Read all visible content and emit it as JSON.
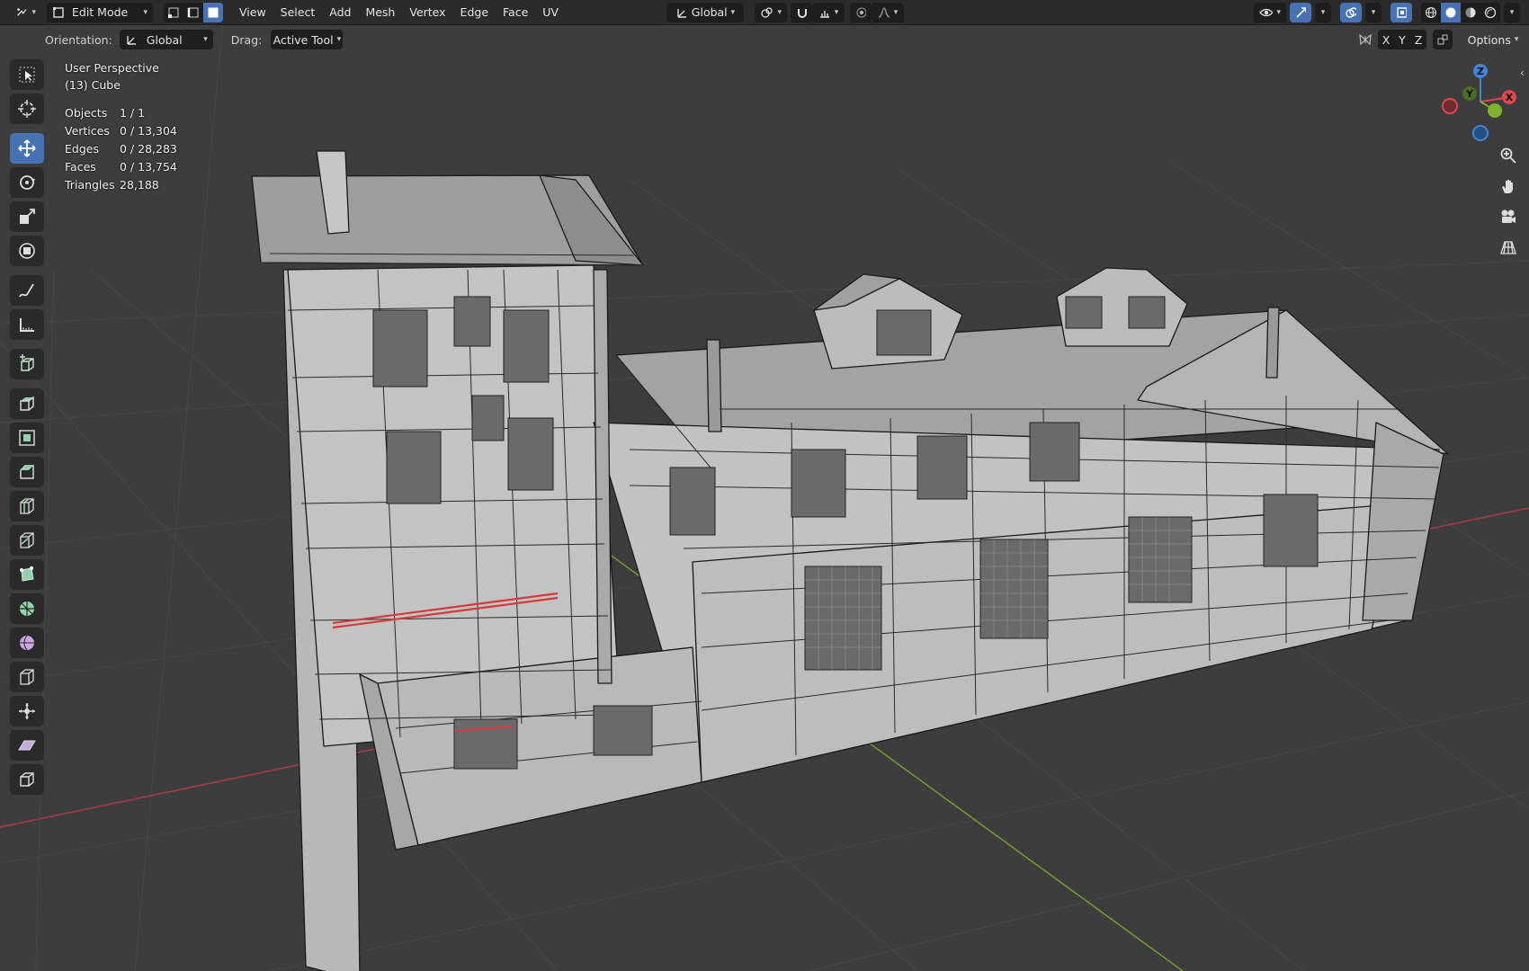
{
  "header": {
    "mode_label": "Edit Mode",
    "menus": [
      "View",
      "Select",
      "Add",
      "Mesh",
      "Vertex",
      "Edge",
      "Face",
      "UV"
    ],
    "transform_orientation": "Global"
  },
  "tool_settings": {
    "orientation_label": "Orientation:",
    "orientation_value": "Global",
    "drag_label": "Drag:",
    "drag_value": "Active Tool",
    "axis_x": "X",
    "axis_y": "Y",
    "axis_z": "Z",
    "options_label": "Options"
  },
  "overlay": {
    "view_name": "User Perspective",
    "object_name": "(13) Cube",
    "stats": [
      {
        "label": "Objects",
        "value": "1 / 1"
      },
      {
        "label": "Vertices",
        "value": "0 / 13,304"
      },
      {
        "label": "Edges",
        "value": "0 / 28,283"
      },
      {
        "label": "Faces",
        "value": "0 / 13,754"
      },
      {
        "label": "Triangles",
        "value": "28,188"
      }
    ]
  },
  "gizmo": {
    "x": "X",
    "y": "Y",
    "z": "Z"
  },
  "colors": {
    "accent": "#4772b3",
    "axis_x": "#e0474d",
    "axis_y": "#7fb32e",
    "axis_z": "#3f85db",
    "background": "#3d3d3d"
  },
  "toolbar_icons": [
    "select-box-icon",
    "cursor-icon",
    "move-icon",
    "rotate-icon",
    "scale-icon",
    "transform-icon",
    "annotate-icon",
    "measure-icon",
    "add-cube-icon",
    "extrude-region-icon",
    "inset-faces-icon",
    "bevel-icon",
    "loop-cut-icon",
    "knife-icon",
    "poly-build-icon",
    "spin-icon",
    "smooth-icon",
    "edge-slide-icon",
    "shrink-fatten-icon",
    "shear-icon",
    "rip-region-icon"
  ]
}
